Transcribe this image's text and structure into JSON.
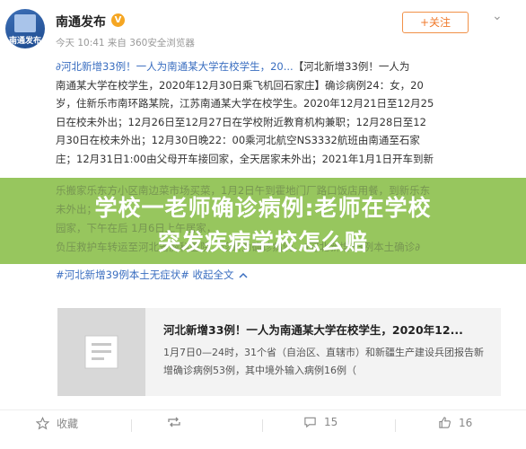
{
  "account": {
    "name": "南通发布",
    "avatar_label": "南通发布",
    "verified_badge": "V",
    "meta": "今天 10:41 来自 360安全浏览器",
    "follow_label": "+关注",
    "more_label": "⌄"
  },
  "post": {
    "link_text": "∂河北新增33例！一人为南通某大学在校学生，20...",
    "lines": [
      "【河北新增33例！一人为",
      "南通某大学在校学生，2020年12月30日乘飞机回石家庄】确诊病例24：女，20",
      "岁，住新乐市南环路某院，江苏南通某大学在校学生。2020年12月21日至12月25",
      "日在校未外出；12月26日至12月27日在学校附近教育机构兼职；12月28日至12",
      "月30日在校未外出；12月30日晚22：00乘河北航空NS3332航班由南通至石家",
      "庄；12月31日1:00由父母开车接回家，全天居家未外出；2021年1月1日开车到新"
    ],
    "ghost_lines": [
      "乐搬家乐东方小区南边菜市场买菜，1月2日午到霍地门厂路口饭店用餐，到新乐东",
      "未外出；",
      "园家，下午在后                      1月6日上午居家，",
      "负压救护车转运至河北省胸科医院，诊断为确诊病例。∂河北新增33例本土确诊∂"
    ],
    "tail_before": "#河北新增39例本土无症状#",
    "tail_after": " 收起全文",
    "collapse_icon": "chevron-up"
  },
  "banner": {
    "line1": "学校一老师确诊病例:老师在学校",
    "line2": "突发疾病学校怎么赔"
  },
  "card": {
    "title": "河北新增33例！一人为南通某大学在校学生，2020年12...",
    "desc": "1月7日0—24时，31个省（自治区、直辖市）和新疆生产建设兵团报告新增确诊病例53例，其中境外输入病例16例（"
  },
  "footer": {
    "favorite": "收藏",
    "repost": "",
    "comment": "15",
    "like": "16"
  },
  "colors": {
    "accent": "#f07a2c",
    "link": "#3a6ec0",
    "banner": "#86bd44"
  }
}
